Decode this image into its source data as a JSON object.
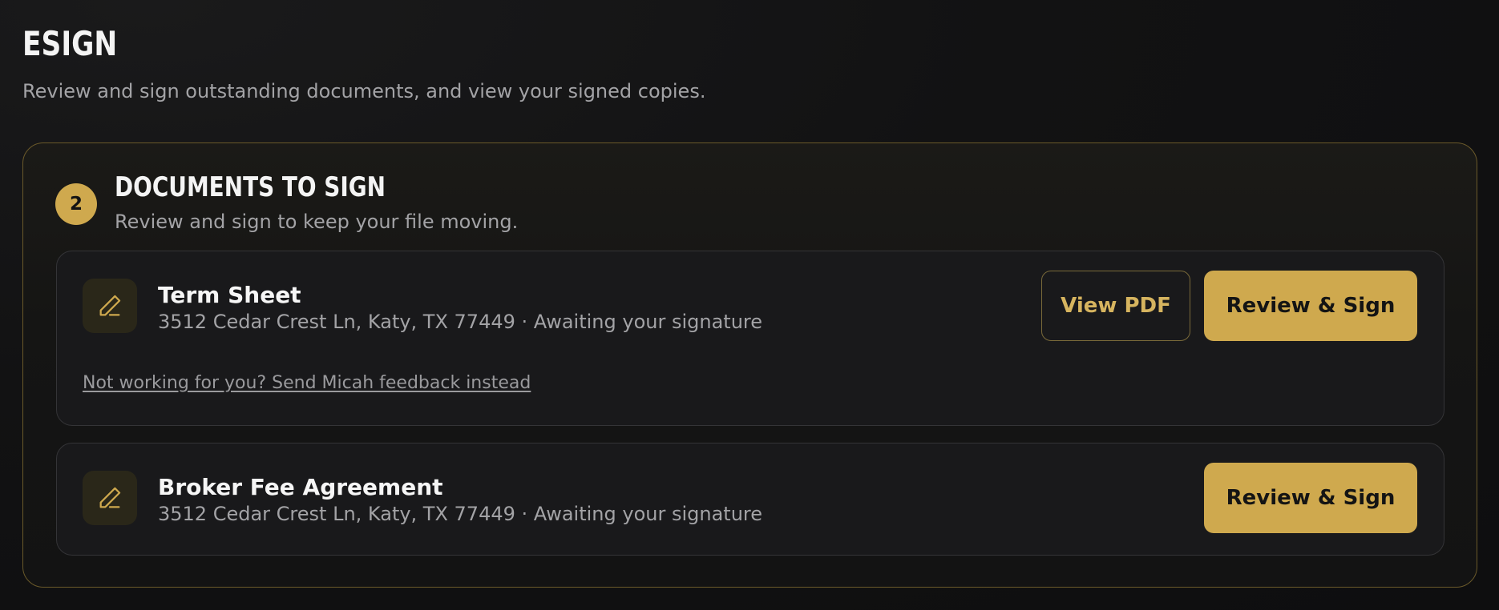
{
  "header": {
    "title": "ESIGN",
    "subtitle": "Review and sign outstanding documents, and view your signed copies."
  },
  "panel": {
    "count": "2",
    "title": "DOCUMENTS TO SIGN",
    "subtitle": "Review and sign to keep your file moving.",
    "accent_color": "#cfa94e"
  },
  "documents": [
    {
      "title": "Term Sheet",
      "meta": "3512 Cedar Crest Ln, Katy, TX 77449 · Awaiting your signature",
      "icon": "pen-icon",
      "view_pdf_label": "View PDF",
      "sign_label": "Review & Sign",
      "feedback_link": "Not working for you? Send Micah feedback instead"
    },
    {
      "title": "Broker Fee Agreement",
      "meta": "3512 Cedar Crest Ln, Katy, TX 77449 · Awaiting your signature",
      "icon": "pen-icon",
      "sign_label": "Review & Sign"
    }
  ]
}
